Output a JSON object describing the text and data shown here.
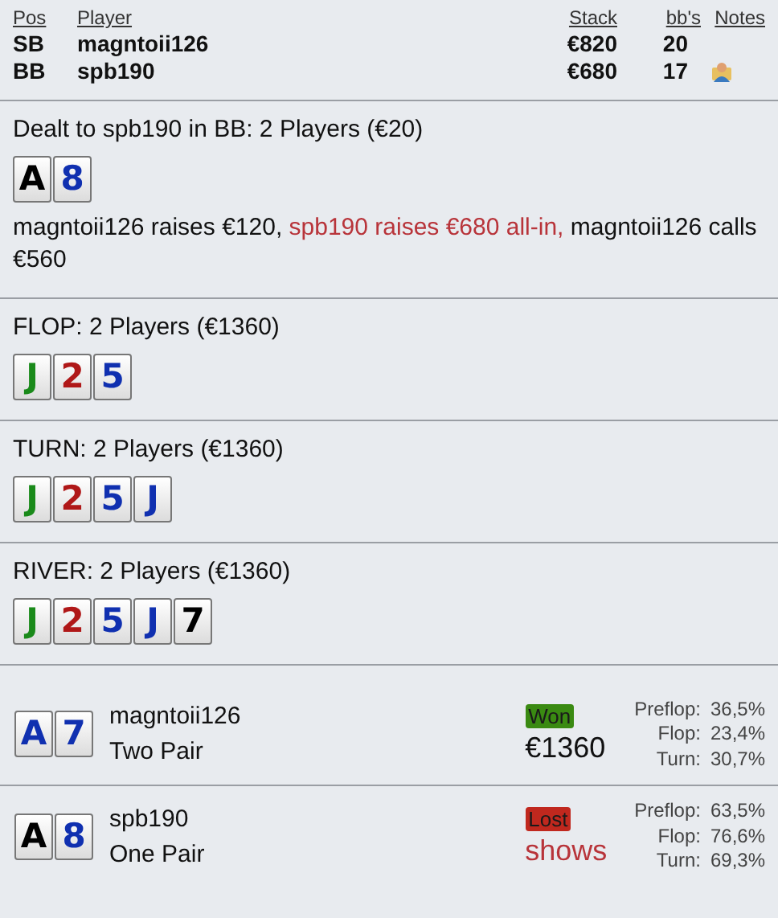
{
  "players_table": {
    "columns": [
      "Pos",
      "Player",
      "Stack",
      "bb's",
      "Notes"
    ],
    "rows": [
      {
        "pos": "SB",
        "player": "magntoii126",
        "stack": "€820",
        "bbs": "20",
        "has_note": false
      },
      {
        "pos": "BB",
        "player": "spb190",
        "stack": "€680",
        "bbs": "17",
        "has_note": true
      }
    ]
  },
  "streets": [
    {
      "title": "Dealt to spb190 in BB: 2 Players (€20)",
      "cards": [
        {
          "rank": "A",
          "color": "#000000"
        },
        {
          "rank": "8",
          "color": "#1030b0"
        }
      ],
      "actions": [
        {
          "text": "magntoii126 raises €120, ",
          "highlight": false
        },
        {
          "text": "spb190 raises €680 all-in, ",
          "highlight": true
        },
        {
          "text": "magntoii126 calls €560",
          "highlight": false
        }
      ]
    },
    {
      "title": "FLOP: 2 Players (€1360)",
      "cards": [
        {
          "rank": "J",
          "color": "#1a8a1a"
        },
        {
          "rank": "2",
          "color": "#b01818"
        },
        {
          "rank": "5",
          "color": "#1030b0"
        }
      ]
    },
    {
      "title": "TURN: 2 Players (€1360)",
      "cards": [
        {
          "rank": "J",
          "color": "#1a8a1a"
        },
        {
          "rank": "2",
          "color": "#b01818"
        },
        {
          "rank": "5",
          "color": "#1030b0"
        },
        {
          "rank": "J",
          "color": "#1030b0"
        }
      ]
    },
    {
      "title": "RIVER: 2 Players (€1360)",
      "cards": [
        {
          "rank": "J",
          "color": "#1a8a1a"
        },
        {
          "rank": "2",
          "color": "#b01818"
        },
        {
          "rank": "5",
          "color": "#1030b0"
        },
        {
          "rank": "J",
          "color": "#1030b0"
        },
        {
          "rank": "7",
          "color": "#000000"
        }
      ]
    }
  ],
  "results": [
    {
      "cards": [
        {
          "rank": "A",
          "color": "#1030b0"
        },
        {
          "rank": "7",
          "color": "#1030b0"
        }
      ],
      "player": "magntoii126",
      "hand": "Two Pair",
      "won": true,
      "badge": "Won",
      "amount": "€1360",
      "equity": [
        {
          "label": "Preflop:",
          "value": "36,5%"
        },
        {
          "label": "Flop:",
          "value": "23,4%"
        },
        {
          "label": "Turn:",
          "value": "30,7%"
        }
      ]
    },
    {
      "cards": [
        {
          "rank": "A",
          "color": "#000000"
        },
        {
          "rank": "8",
          "color": "#1030b0"
        }
      ],
      "player": "spb190",
      "hand": "One Pair",
      "won": false,
      "badge": "Lost",
      "amount": "shows",
      "equity": [
        {
          "label": "Preflop:",
          "value": "63,5%"
        },
        {
          "label": "Flop:",
          "value": "76,6%"
        },
        {
          "label": "Turn:",
          "value": "69,3%"
        }
      ]
    }
  ]
}
